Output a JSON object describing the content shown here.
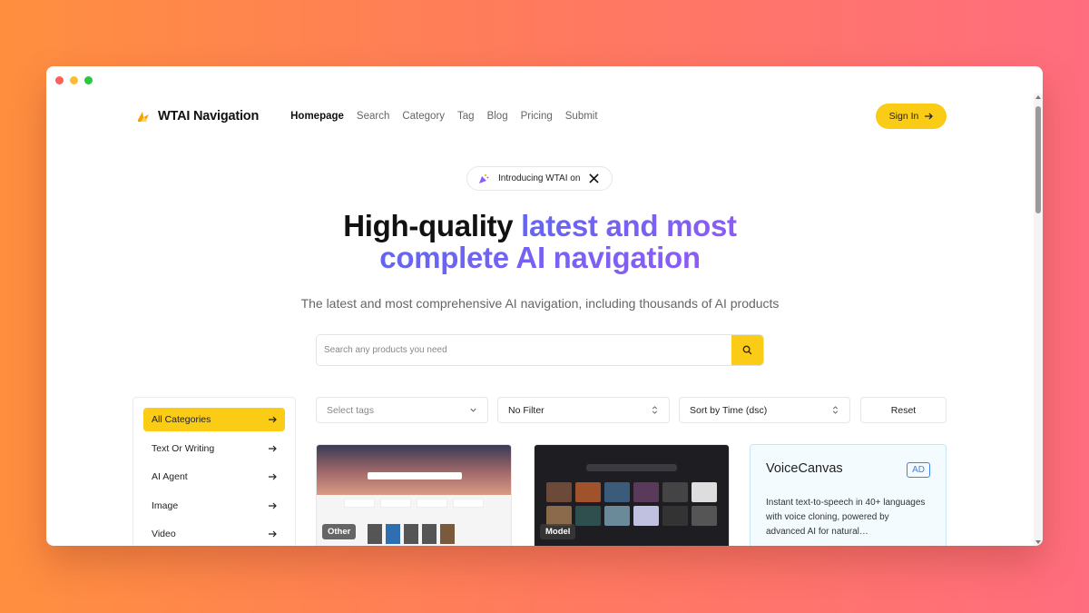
{
  "nav": {
    "brand": "WTAI Navigation",
    "items": [
      "Homepage",
      "Search",
      "Category",
      "Tag",
      "Blog",
      "Pricing",
      "Submit"
    ],
    "active": "Homepage",
    "signin": "Sign In"
  },
  "hero": {
    "pill": "Introducing WTAI on",
    "title_plain": "High-quality ",
    "title_grad_1": "latest and most",
    "title_grad_2": "complete AI navigation",
    "subtitle": "The latest and most comprehensive AI navigation, including thousands of AI products"
  },
  "search": {
    "placeholder": "Search any products you need"
  },
  "sidebar": {
    "items": [
      "All Categories",
      "Text Or Writing",
      "AI Agent",
      "Image",
      "Video"
    ],
    "active": "All Categories"
  },
  "filters": {
    "tags": "Select tags",
    "filter": "No Filter",
    "sort": "Sort by Time (dsc)",
    "reset": "Reset"
  },
  "cards": [
    {
      "tag": "Other"
    },
    {
      "tag": "Model"
    },
    {
      "title": "VoiceCanvas",
      "badge": "AD",
      "desc": "Instant text-to-speech in 40+ languages with voice cloning, powered by advanced AI for natural…"
    }
  ],
  "colors": {
    "accent": "#facc15",
    "gradient_start": "#6366f1",
    "gradient_end": "#8b5cf6"
  }
}
